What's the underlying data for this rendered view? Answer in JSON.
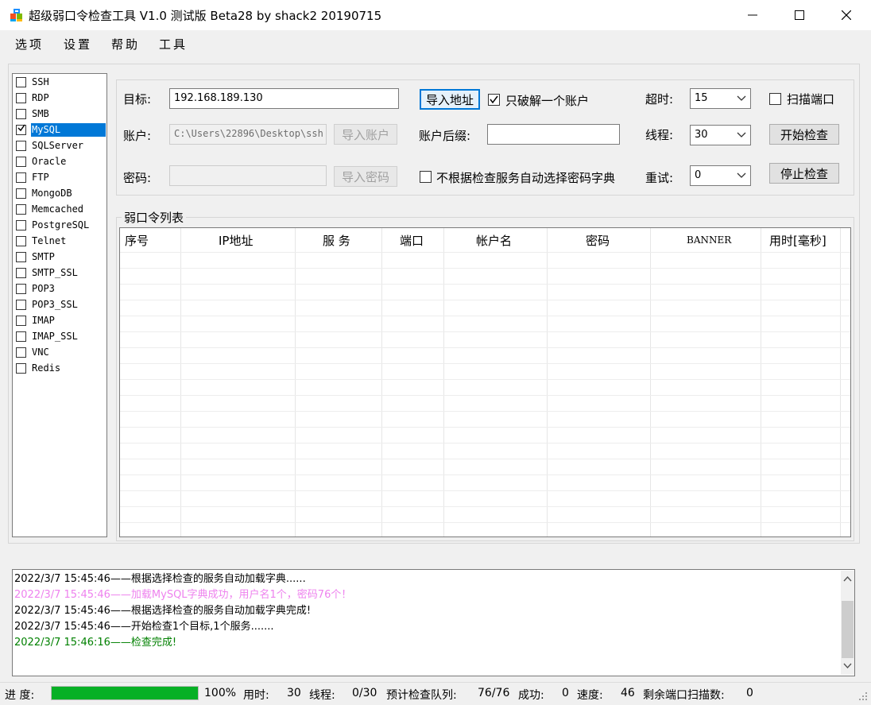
{
  "window": {
    "title": "超级弱口令检查工具 V1.0 测试版 Beta28 by shack2 20190715",
    "icon": "app-windows-icon"
  },
  "menu": [
    "选项",
    "设置",
    "帮助",
    "工具"
  ],
  "services": [
    {
      "label": "SSH",
      "checked": false,
      "selected": false
    },
    {
      "label": "RDP",
      "checked": false,
      "selected": false
    },
    {
      "label": "SMB",
      "checked": false,
      "selected": false
    },
    {
      "label": "MySQL",
      "checked": true,
      "selected": true
    },
    {
      "label": "SQLServer",
      "checked": false,
      "selected": false
    },
    {
      "label": "Oracle",
      "checked": false,
      "selected": false
    },
    {
      "label": "FTP",
      "checked": false,
      "selected": false
    },
    {
      "label": "MongoDB",
      "checked": false,
      "selected": false
    },
    {
      "label": "Memcached",
      "checked": false,
      "selected": false
    },
    {
      "label": "PostgreSQL",
      "checked": false,
      "selected": false
    },
    {
      "label": "Telnet",
      "checked": false,
      "selected": false
    },
    {
      "label": "SMTP",
      "checked": false,
      "selected": false
    },
    {
      "label": "SMTP_SSL",
      "checked": false,
      "selected": false
    },
    {
      "label": "POP3",
      "checked": false,
      "selected": false
    },
    {
      "label": "POP3_SSL",
      "checked": false,
      "selected": false
    },
    {
      "label": "IMAP",
      "checked": false,
      "selected": false
    },
    {
      "label": "IMAP_SSL",
      "checked": false,
      "selected": false
    },
    {
      "label": "VNC",
      "checked": false,
      "selected": false
    },
    {
      "label": "Redis",
      "checked": false,
      "selected": false
    }
  ],
  "config": {
    "target_label": "目标:",
    "target_value": "192.168.189.130",
    "import_address": "导入地址",
    "only_one_account": "只破解一个账户",
    "only_one_account_checked": true,
    "timeout_label": "超时:",
    "timeout_value": "15",
    "scan_port": "扫描端口",
    "scan_port_checked": false,
    "account_label": "账户:",
    "account_value": "C:\\Users\\22896\\Desktop\\ssh",
    "import_account": "导入账户",
    "account_suffix_label": "账户后缀:",
    "account_suffix_value": "",
    "threads_label": "线程:",
    "threads_value": "30",
    "start_check": "开始检查",
    "password_label": "密码:",
    "password_value": "",
    "import_password": "导入密码",
    "no_auto_dict": "不根据检查服务自动选择密码字典",
    "no_auto_dict_checked": false,
    "retry_label": "重试:",
    "retry_value": "0",
    "stop_check": "停止检查"
  },
  "list": {
    "title": "弱口令列表",
    "columns": [
      "序号",
      "IP地址",
      "服 务",
      "端口",
      "帐户名",
      "密码",
      "BANNER",
      "用时[毫秒]"
    ],
    "rows": []
  },
  "log": [
    {
      "text": "2022/3/7 15:45:46——根据选择检查的服务自动加载字典......",
      "color": "#000000"
    },
    {
      "text": "2022/3/7 15:45:46——加载MySQL字典成功，用户名1个，密码76个！",
      "color": "#ee82ee"
    },
    {
      "text": "2022/3/7 15:45:46——根据选择检查的服务自动加载字典完成!",
      "color": "#000000"
    },
    {
      "text": "2022/3/7 15:45:46——开始检查1个目标,1个服务.......",
      "color": "#000000"
    },
    {
      "text": "2022/3/7 15:46:16——检查完成!",
      "color": "#008000"
    }
  ],
  "status": {
    "progress_label": "进 度:",
    "progress_percent": 100,
    "progress_text": "100%",
    "time_label": "用时:",
    "time_value": "30",
    "threads_label": "线程:",
    "threads_value": "0/30",
    "queue_label": "预计检查队列:",
    "queue_value": "76/76",
    "success_label": "成功:",
    "success_value": "0",
    "speed_label": "速度:",
    "speed_value": "46",
    "remaining_label": "剩余端口扫描数:",
    "remaining_value": "0"
  }
}
